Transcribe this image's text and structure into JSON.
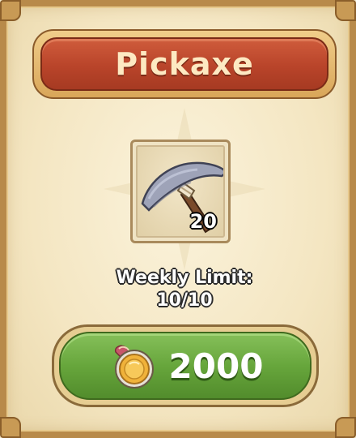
{
  "dialog": {
    "title": "Pickaxe"
  },
  "item": {
    "icon": "pickaxe-icon",
    "count": "20"
  },
  "limit": {
    "label": "Weekly Limit:",
    "value": "10/10"
  },
  "purchase": {
    "currency_icon": "gold-coin-icon",
    "price": "2000"
  },
  "colors": {
    "title_banner": "#b9442a",
    "buy_button": "#67a63c",
    "panel": "#f4e6c2"
  }
}
